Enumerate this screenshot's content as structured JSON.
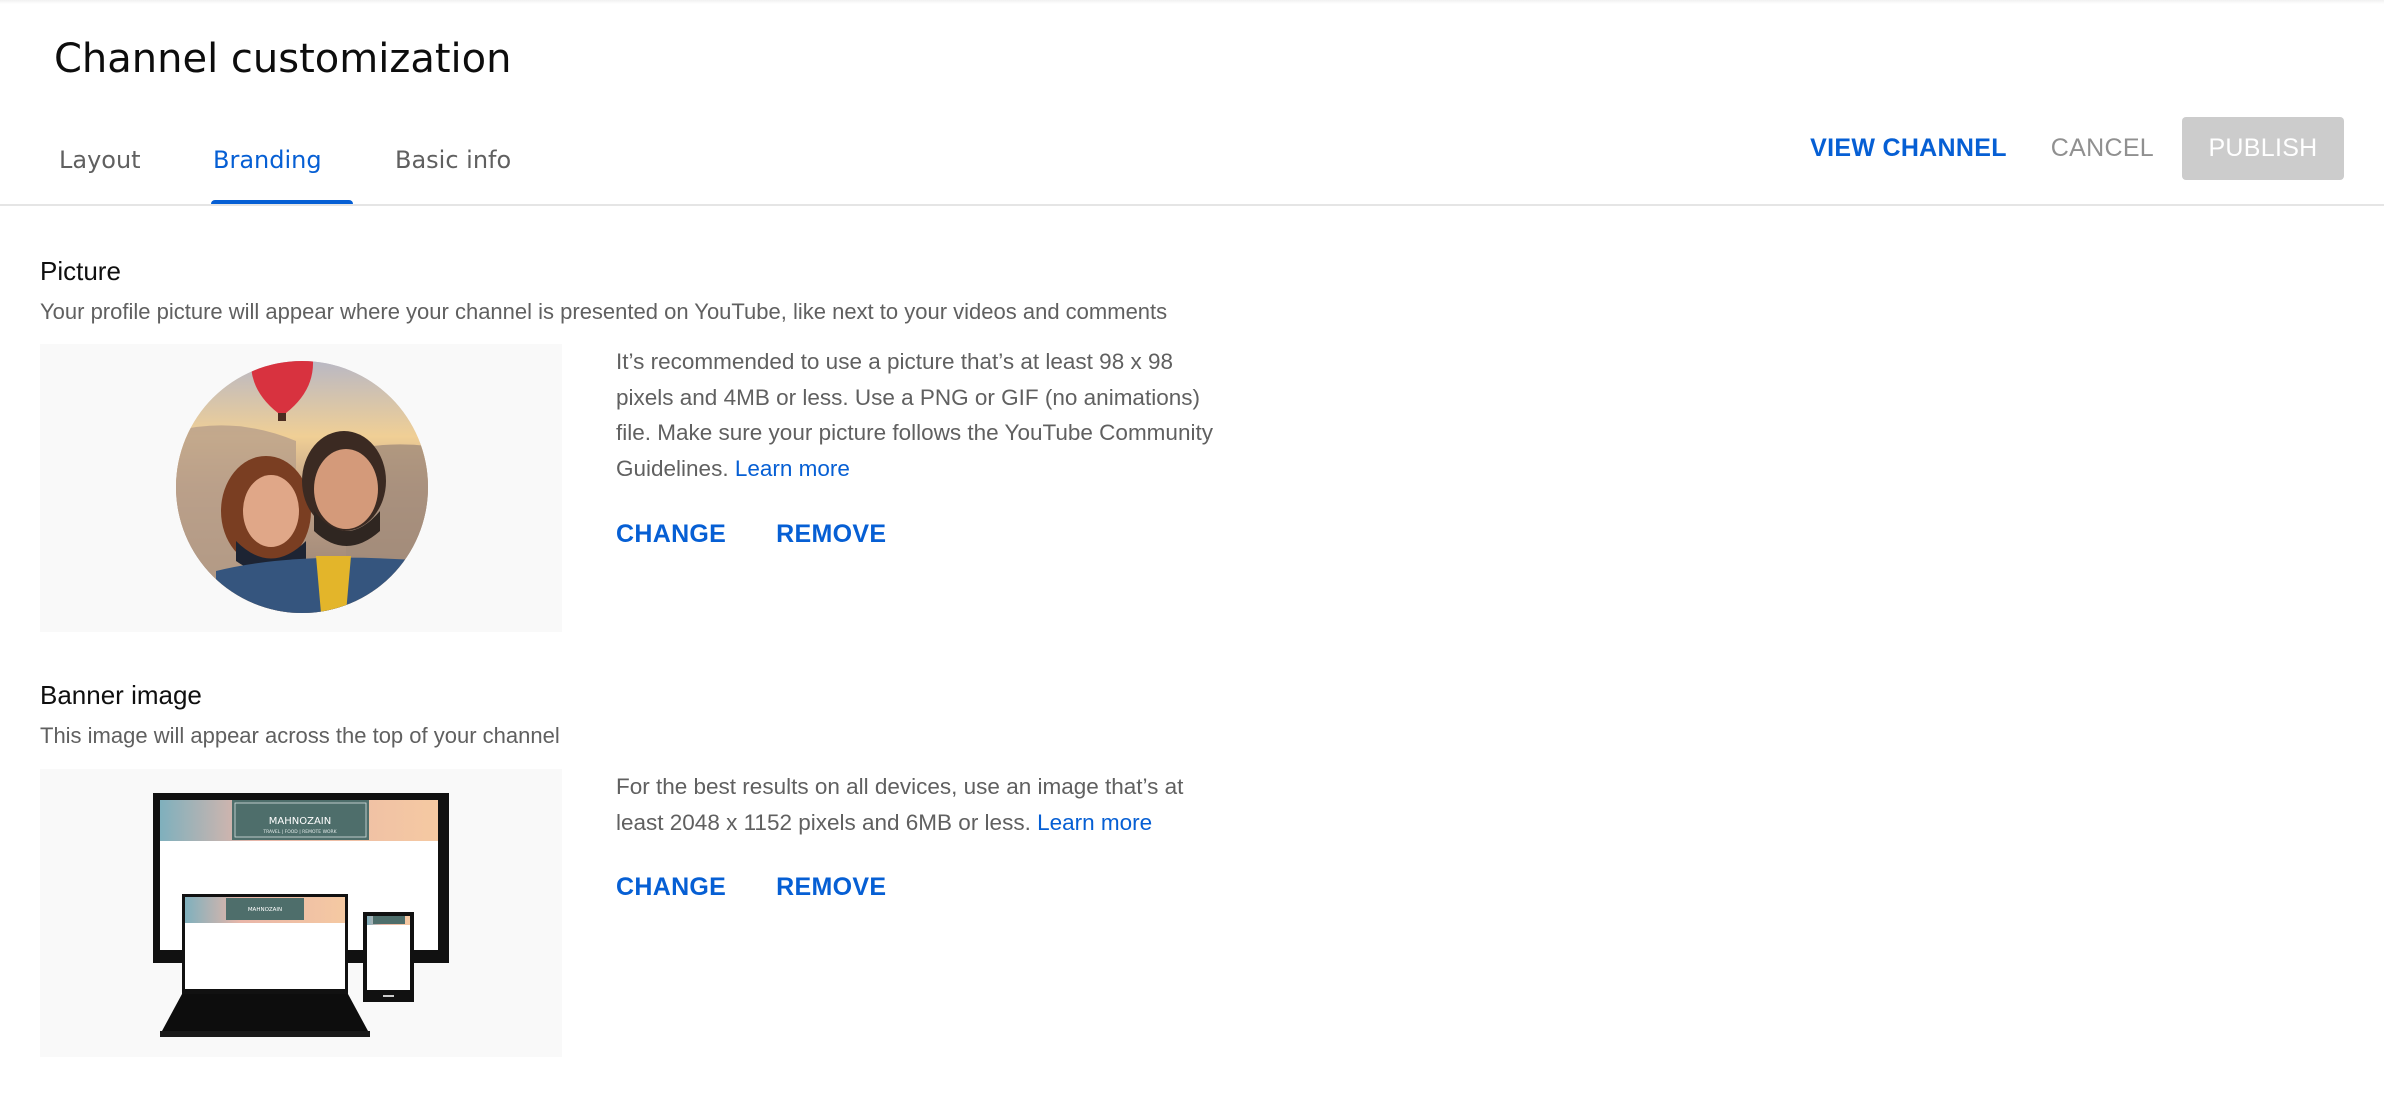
{
  "page": {
    "title": "Channel customization"
  },
  "tabs": [
    {
      "label": "Layout",
      "active": false
    },
    {
      "label": "Branding",
      "active": true
    },
    {
      "label": "Basic info",
      "active": false
    }
  ],
  "actions": {
    "view_channel": "VIEW CHANNEL",
    "cancel": "CANCEL",
    "publish": "PUBLISH"
  },
  "picture": {
    "title": "Picture",
    "description": "Your profile picture will appear where your channel is presented on YouTube, like next to your videos and comments",
    "info": "It’s recommended to use a picture that’s at least 98 x 98 pixels and 4MB or less. Use a PNG or GIF (no animations) file. Make sure your picture follows the YouTube Community Guidelines.",
    "learn_more": "Learn more",
    "change": "CHANGE",
    "remove": "REMOVE"
  },
  "banner": {
    "title": "Banner image",
    "description": "This image will appear across the top of your channel",
    "info": "For the best results on all devices, use an image that’s at least 2048 x 1152 pixels and 6MB or less.",
    "learn_more": "Learn more",
    "change": "CHANGE",
    "remove": "REMOVE",
    "channel_name": "MAHNOZAIN",
    "tagline": "TRAVEL | FOOD | REMOTE WORK"
  },
  "colors": {
    "accent": "#065fd4",
    "secondary_text": "#606060",
    "disabled_button": "#cccccc",
    "preview_bg": "#f9f9f9"
  }
}
